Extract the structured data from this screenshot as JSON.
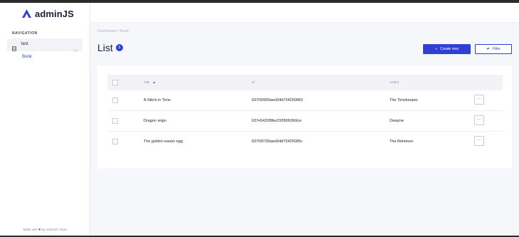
{
  "app": {
    "brand_name": "adminJS"
  },
  "sidebar": {
    "heading": "NAVIGATION",
    "group_label": "test",
    "items": [
      {
        "label": "Book"
      }
    ],
    "footer_prefix": "Made with",
    "footer_heart": "♥",
    "footer_suffix": "by AdminJS Team"
  },
  "breadcrumb": {
    "text": "Dashboard / Book"
  },
  "page": {
    "title": "List",
    "count": "3",
    "create_label": "Create new",
    "create_icon": "+",
    "filter_label": "Filter",
    "filter_icon": "⇄"
  },
  "table": {
    "columns": [
      {
        "label": "Title",
        "sort": "▲"
      },
      {
        "label": "Id"
      },
      {
        "label": "Author"
      }
    ],
    "rows": [
      {
        "title": "A Stitch in Time",
        "id": "637f30950aed34d734250860",
        "author": "The Timekeeper",
        "action": "···"
      },
      {
        "title": "Dragon reign",
        "id": "637e5433f9be233f9002b9ce",
        "author": "Dwayne",
        "action": "···"
      },
      {
        "title": "The golden easter egg",
        "id": "637f30790aed34d73425085c",
        "author": "The Retriever",
        "action": "···"
      }
    ]
  },
  "colors": {
    "accent": "#3040d6",
    "text": "#1c1c38",
    "muted": "#898a9a",
    "background": "#f6f7fb"
  },
  "icons": {
    "brand": "adminjs-logo-icon",
    "resource": "database-icon",
    "group_toggle": "chevron-up-icon",
    "row_menu": "more-horizontal-icon"
  }
}
